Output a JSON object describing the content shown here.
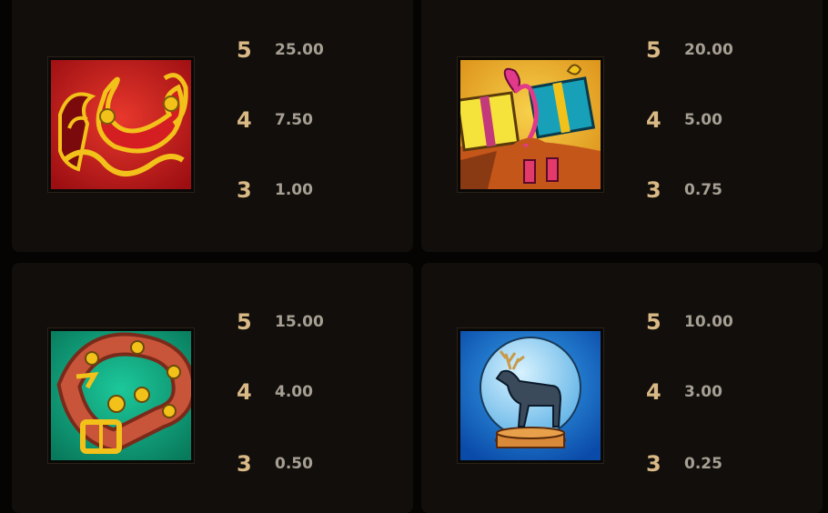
{
  "symbols": [
    {
      "icon": "sleigh-icon",
      "background": "#c8181c",
      "pays": [
        {
          "count": "5",
          "value": "25.00"
        },
        {
          "count": "4",
          "value": "7.50"
        },
        {
          "count": "3",
          "value": "1.00"
        }
      ]
    },
    {
      "icon": "gift-boxes-icon",
      "background": "#e2a21c",
      "pays": [
        {
          "count": "5",
          "value": "20.00"
        },
        {
          "count": "4",
          "value": "5.00"
        },
        {
          "count": "3",
          "value": "0.75"
        }
      ]
    },
    {
      "icon": "bell-collar-icon",
      "background": "#0c9a78",
      "pays": [
        {
          "count": "5",
          "value": "15.00"
        },
        {
          "count": "4",
          "value": "4.00"
        },
        {
          "count": "3",
          "value": "0.50"
        }
      ]
    },
    {
      "icon": "reindeer-snow-globe-icon",
      "background": "#1c7cd8",
      "pays": [
        {
          "count": "5",
          "value": "10.00"
        },
        {
          "count": "4",
          "value": "3.00"
        },
        {
          "count": "3",
          "value": "0.25"
        }
      ]
    }
  ],
  "colors": {
    "page_background": "#050402",
    "card_background": "#120e0b",
    "count_text": "#d9b985",
    "payout_text": "#a69f93"
  }
}
